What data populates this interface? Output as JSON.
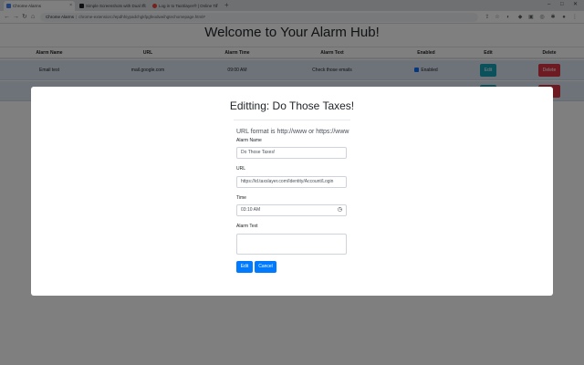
{
  "browser": {
    "tabs": [
      {
        "title": "Chrome Alarms",
        "active": true,
        "favicon_color": "#4285f4"
      },
      {
        "title": "Simple Screenshots with Dual Sc",
        "active": false,
        "favicon_color": "#202124"
      },
      {
        "title": "Log in to TaxSlayer® | Online Ta",
        "active": false,
        "favicon_color": "#e8453c"
      }
    ],
    "new_tab": "+",
    "address": {
      "site": "Chrome Alarms",
      "url": "chrome-extension://epdhhiypadchgkfpgfeodweihgtechomepage.html#"
    }
  },
  "page": {
    "title": "Welcome to Your Alarm Hub!",
    "columns": [
      "Alarm Name",
      "URL",
      "Alarm Time",
      "Alarm Text",
      "Enabled",
      "Edit",
      "Delete"
    ],
    "rows": [
      {
        "name": "Email test",
        "url": "mail.google.com",
        "time": "09:00 AM",
        "text": "Check those emails",
        "enabled_label": "Enabled",
        "edit_label": "Edit",
        "delete_label": "Delete"
      }
    ]
  },
  "modal": {
    "title": "Editting: Do Those Taxes!",
    "hint": "URL format is http://www or https://www",
    "name_label": "Alarm Name",
    "name_value": "Do Those Taxes!",
    "url_label": "URL",
    "url_value": "https://id.taxslayer.com/Identity/Account/Login",
    "time_label": "Time",
    "time_value": "03:10 AM",
    "text_label": "Alarm Text",
    "text_value": "",
    "edit_button": "Edit",
    "cancel_button": "Cancel"
  },
  "colors": {
    "primary": "#007bff",
    "info": "#17a2b8",
    "danger": "#dc3545",
    "row_highlight": "#dbe6f3"
  }
}
